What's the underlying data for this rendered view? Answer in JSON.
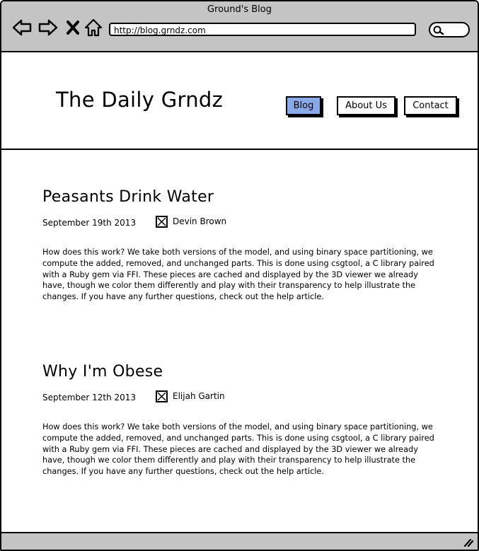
{
  "browser": {
    "window_title": "Ground's Blog",
    "url": "http://blog.grndz.com"
  },
  "site": {
    "brand": "The Daily Grndz",
    "nav": [
      "Blog",
      "About Us",
      "Contact"
    ],
    "active_nav": "Blog",
    "active_color": "#8aa9e8"
  },
  "posts": [
    {
      "title": "Peasants Drink Water",
      "date": "September 19th 2013",
      "author": "Devin Brown",
      "body": "How does this work? We take both versions of the model, and using binary space partitioning, we compute the added, removed, and unchanged parts. This is done using csgtool, a C library paired with a Ruby gem via FFI. These pieces are cached and displayed by the 3D viewer we already have, though we color them differently and play with their transparency to help illustrate the changes. If you have any further questions, check out the help article."
    },
    {
      "title": "Why I'm Obese",
      "date": "September 12th 2013",
      "author": "Elijah Gartin",
      "body": "How does this work? We take both versions of the model, and using binary space partitioning, we compute the added, removed, and unchanged parts. This is done using csgtool, a C library paired with a Ruby gem via FFI. These pieces are cached and displayed by the 3D viewer we already have, though we color them differently and play with their transparency to help illustrate the changes. If you have any further questions, check out the help article."
    }
  ]
}
